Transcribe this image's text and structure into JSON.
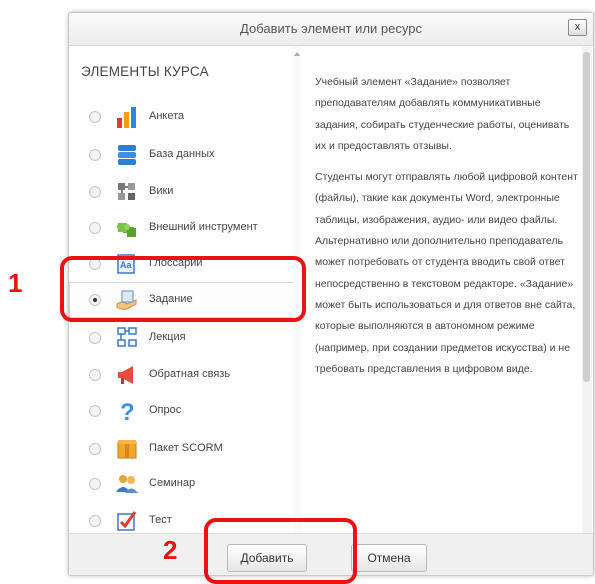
{
  "dialog": {
    "title": "Добавить элемент или ресурс",
    "close_label": "x"
  },
  "left_panel": {
    "section_title": "ЭЛЕМЕНТЫ КУРСА",
    "items": [
      {
        "label": "Анкета",
        "icon": "survey-icon",
        "selected": false
      },
      {
        "label": "База данных",
        "icon": "database-icon",
        "selected": false
      },
      {
        "label": "Вики",
        "icon": "wiki-icon",
        "selected": false
      },
      {
        "label": "Внешний инструмент",
        "icon": "external-tool-icon",
        "selected": false
      },
      {
        "label": "Глоссарий",
        "icon": "glossary-icon",
        "selected": false
      },
      {
        "label": "Задание",
        "icon": "assignment-icon",
        "selected": true
      },
      {
        "label": "Лекция",
        "icon": "lesson-icon",
        "selected": false
      },
      {
        "label": "Обратная связь",
        "icon": "feedback-icon",
        "selected": false
      },
      {
        "label": "Опрос",
        "icon": "choice-icon",
        "selected": false
      },
      {
        "label": "Пакет SCORM",
        "icon": "scorm-icon",
        "selected": false
      },
      {
        "label": "Семинар",
        "icon": "workshop-icon",
        "selected": false
      },
      {
        "label": "Тест",
        "icon": "quiz-icon",
        "selected": false
      }
    ]
  },
  "description": {
    "paragraphs": [
      "Учебный элемент «Задание» позволяет преподавателям добавлять коммуникативные задания, собирать студенческие работы, оценивать их и предоставлять отзывы.",
      "Студенты могут отправлять любой цифровой контент (файлы), такие как документы Word, электронные таблицы, изображения, аудио- или видео файлы. Альтернативно или дополнительно преподаватель может потребовать от студента вводить свой ответ непосредственно в текстовом редакторе. «Задание» может быть использоваться и для ответов вне сайта, которые выполняются в автономном режиме (например, при создании предметов искусства) и не требовать представления в цифровом виде."
    ]
  },
  "footer": {
    "add_label": "Добавить",
    "cancel_label": "Отмена"
  },
  "annotations": {
    "step1": "1",
    "step2": "2",
    "color": "#ee1111"
  }
}
